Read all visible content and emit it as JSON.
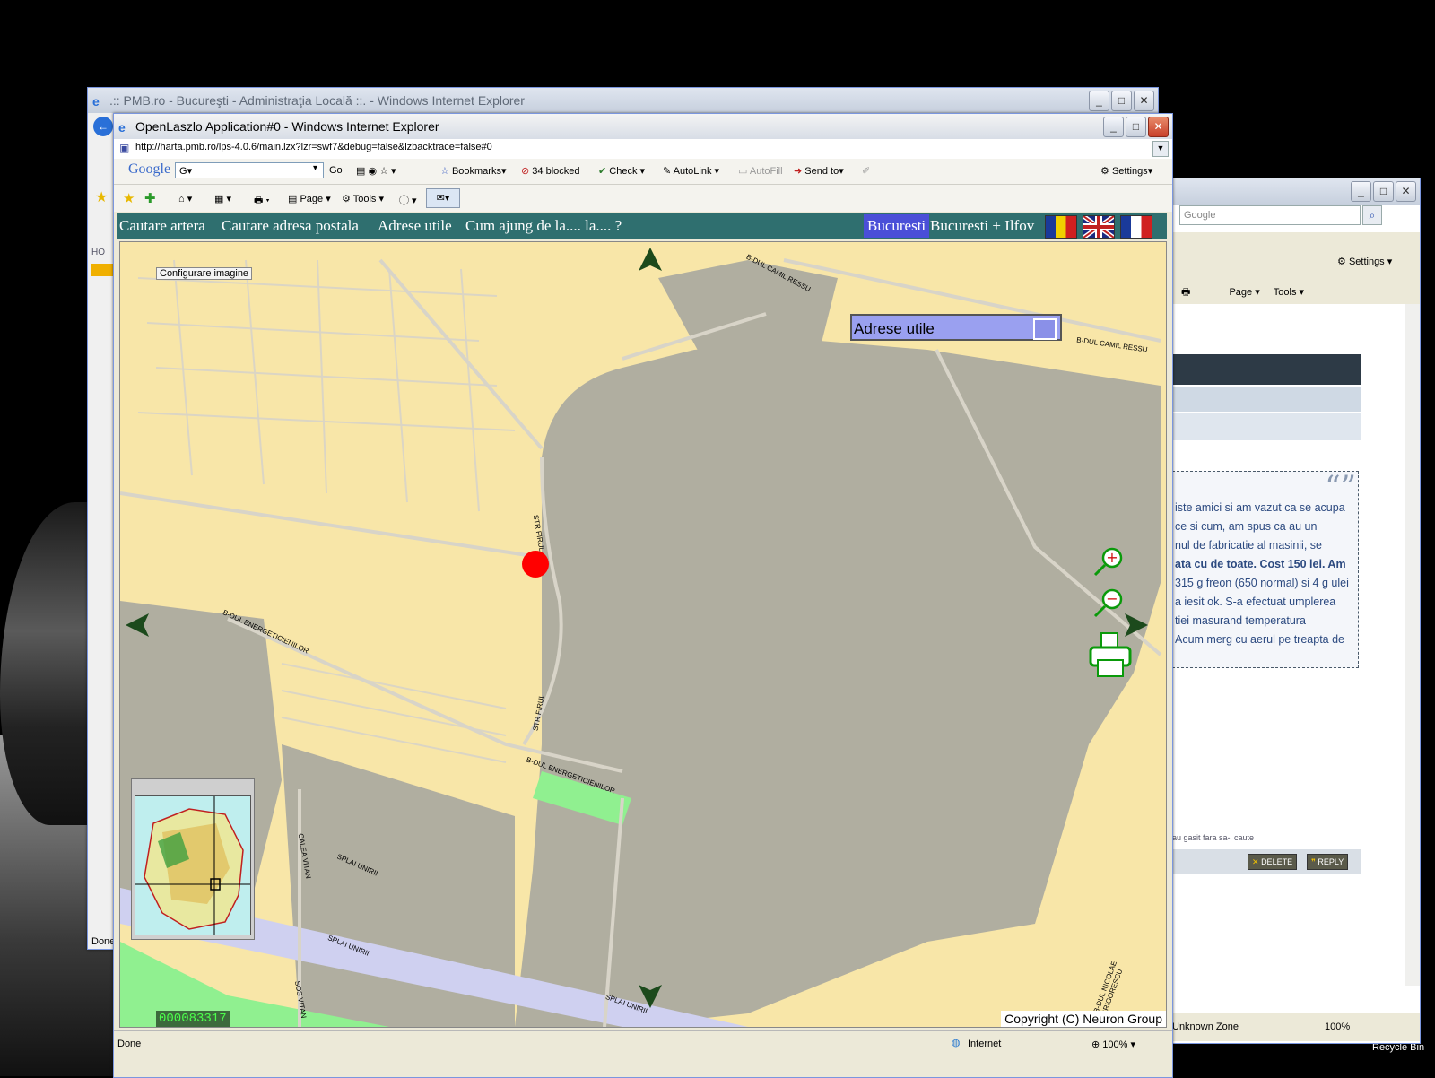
{
  "desktop": {
    "recycle_bin_label": "Recycle Bin"
  },
  "back_window": {
    "title": ".:: PMB.ro - Bucureşti - Administraţia Locală ::. - Windows Internet Explorer",
    "side_label": "HO",
    "status": "Done"
  },
  "right_window": {
    "search_placeholder": "Google",
    "settings_label": "Settings",
    "page_label": "Page",
    "tools_label": "Tools",
    "quote_lines": [
      "iste amici si am vazut ca se acupa",
      "ce si cum, am spus ca au un",
      "nul de fabricatie al masinii, se",
      "ata cu de toate. Cost 150 lei. Am",
      "315 g freon (650 normal) si 4 g ulei",
      "a iesit ok. S-a efectuat umplerea",
      "tiei masurand temperatura",
      "Acum merg cu aerul pe treapta de"
    ],
    "found_text": "au gasit fara sa-l caute",
    "delete_label": "DELETE",
    "reply_label": "REPLY",
    "status_zone": "Unknown Zone",
    "zoom": "100%"
  },
  "main_window": {
    "title": "OpenLaszlo Application#0 - Windows Internet Explorer",
    "url": "http://harta.pmb.ro/lps-4.0.6/main.lzx?lzr=swf7&debug=false&lzbacktrace=false#0",
    "google_toolbar": {
      "logo": "Google",
      "search_value": "G",
      "go_label": "Go",
      "bookmarks_label": "Bookmarks",
      "blocked_label": "34 blocked",
      "check_label": "Check",
      "autolink_label": "AutoLink",
      "autofill_label": "AutoFill",
      "sendto_label": "Send to",
      "settings_label": "Settings"
    },
    "command_bar": {
      "page_label": "Page",
      "tools_label": "Tools"
    },
    "status": {
      "done": "Done",
      "zone": "Internet",
      "zoom": "100%"
    }
  },
  "app": {
    "nav": {
      "cautare_artera": "Cautare artera",
      "cautare_adresa": "Cautare adresa postala",
      "adrese_utile": "Adrese utile",
      "cum_ajung": "Cum ajung de la.... la.... ?",
      "bucuresti": "Bucuresti",
      "bucuresti_ilfov": "Bucuresti + Ilfov"
    },
    "map": {
      "configure_label": "Configurare imagine",
      "adrese_box_title": "Adrese utile",
      "copyright": "Copyright (C) Neuron Group",
      "counter": "000083317",
      "street_labels": [
        "B-DUL CAMIL RESSU",
        "B-DUL CAMIL RESSU",
        "STR FIRUL",
        "B-DUL ENERGETICIENILOR",
        "B-DUL ENERGETICIENILOR",
        "CALEA VITAN",
        "SPLAI UNIRII",
        "SPLAI UNIRII",
        "SPLAI UNIRII",
        "SOS VITAN",
        "B-DUL NICOLAE GRIGORESCU",
        "STR FIRUL"
      ]
    }
  },
  "colors": {
    "map_land": "#f8e6a8",
    "map_park": "#b0aea0",
    "map_river": "#cfd0f0",
    "nav_bg": "#2f6f6f",
    "accent_marker": "#ff0000"
  }
}
